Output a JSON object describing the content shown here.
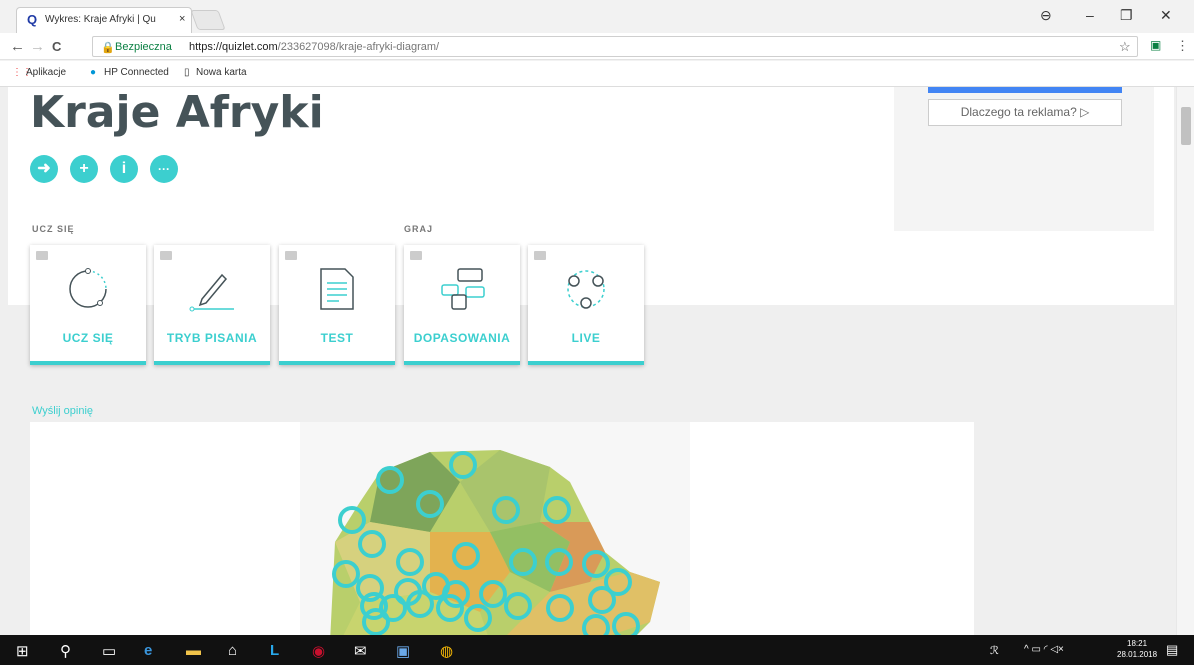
{
  "browser": {
    "tab_title": "Wykres: Kraje Afryki | Qu",
    "tab_close": "×",
    "secure_label": "Bezpieczna",
    "url_host": "https://quizlet.com",
    "url_path": "/233627098/kraje-afryki-diagram/",
    "bookmarks": [
      "Aplikacje",
      "HP Connected",
      "Nowa karta"
    ]
  },
  "page": {
    "title": "Kraje Afryki",
    "section_learn": "UCZ SIĘ",
    "section_play": "GRAJ",
    "feedback_link": "Wyślij opinię",
    "modes": [
      {
        "label": "UCZ SIĘ",
        "icon": "learn-icon"
      },
      {
        "label": "TRYB PISANIA",
        "icon": "pencil-icon"
      },
      {
        "label": "TEST",
        "icon": "test-icon"
      },
      {
        "label": "DOPASOWANIA",
        "icon": "match-icon"
      },
      {
        "label": "LIVE",
        "icon": "live-icon"
      }
    ],
    "actions": [
      "share-icon",
      "plus-icon",
      "info-icon",
      "more-icon"
    ]
  },
  "ad": {
    "why_label": "Dlaczego ta reklama? ▷"
  },
  "taskbar": {
    "time": "18:21",
    "date": "28.01.2018"
  },
  "colors": {
    "accent": "#3ccfcf",
    "title": "#455358"
  }
}
